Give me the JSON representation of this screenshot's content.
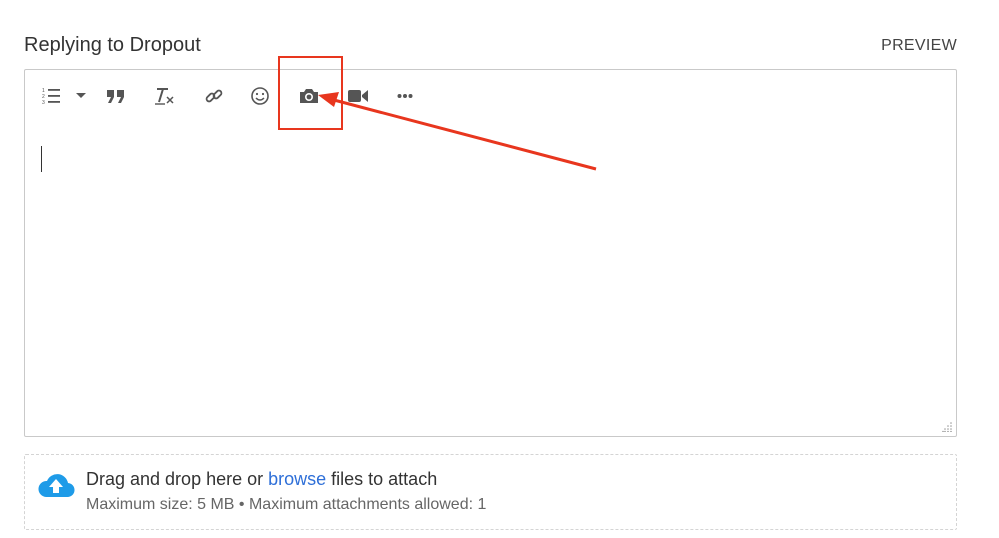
{
  "header": {
    "title": "Replying to Dropout",
    "preview_label": "PREVIEW"
  },
  "toolbar": {
    "items": [
      {
        "name": "numbered-list-icon"
      },
      {
        "name": "chevron-down-icon"
      },
      {
        "name": "quote-icon"
      },
      {
        "name": "clear-format-icon"
      },
      {
        "name": "link-icon"
      },
      {
        "name": "emoji-icon"
      },
      {
        "name": "camera-icon"
      },
      {
        "name": "video-icon"
      },
      {
        "name": "more-icon"
      }
    ]
  },
  "editor": {
    "content": ""
  },
  "annotation": {
    "color": "#e8361e"
  },
  "dropzone": {
    "text_before": "Drag and drop here or ",
    "browse_label": "browse",
    "text_after": " files to attach",
    "limits_text": "Maximum size: 5 MB • Maximum attachments allowed: 1",
    "cloud_color": "#1e9be8",
    "link_color": "#2e6fd8"
  }
}
